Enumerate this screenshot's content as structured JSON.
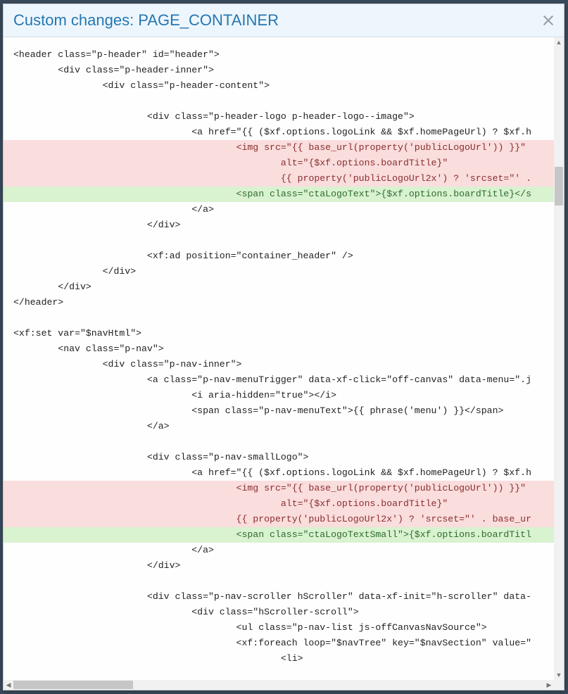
{
  "title": "Custom changes: PAGE_CONTAINER",
  "lines": [
    {
      "kind": "norm",
      "text": "<header class=\"p-header\" id=\"header\">"
    },
    {
      "kind": "norm",
      "text": "        <div class=\"p-header-inner\">"
    },
    {
      "kind": "norm",
      "text": "                <div class=\"p-header-content\">"
    },
    {
      "kind": "norm",
      "text": ""
    },
    {
      "kind": "norm",
      "text": "                        <div class=\"p-header-logo p-header-logo--image\">"
    },
    {
      "kind": "norm",
      "text": "                                <a href=\"{{ ($xf.options.logoLink && $xf.homePageUrl) ? $xf.h"
    },
    {
      "kind": "del",
      "text": "                                        <img src=\"{{ base_url(property('publicLogoUrl')) }}\""
    },
    {
      "kind": "del",
      "text": "                                                alt=\"{$xf.options.boardTitle}\""
    },
    {
      "kind": "del",
      "text": "                                                {{ property('publicLogoUrl2x') ? 'srcset=\"' ."
    },
    {
      "kind": "add",
      "text": "                                        <span class=\"ctaLogoText\">{$xf.options.boardTitle}</s"
    },
    {
      "kind": "norm",
      "text": "                                </a>"
    },
    {
      "kind": "norm",
      "text": "                        </div>"
    },
    {
      "kind": "norm",
      "text": ""
    },
    {
      "kind": "norm",
      "text": "                        <xf:ad position=\"container_header\" />"
    },
    {
      "kind": "norm",
      "text": "                </div>"
    },
    {
      "kind": "norm",
      "text": "        </div>"
    },
    {
      "kind": "norm",
      "text": "</header>"
    },
    {
      "kind": "norm",
      "text": ""
    },
    {
      "kind": "norm",
      "text": "<xf:set var=\"$navHtml\">"
    },
    {
      "kind": "norm",
      "text": "        <nav class=\"p-nav\">"
    },
    {
      "kind": "norm",
      "text": "                <div class=\"p-nav-inner\">"
    },
    {
      "kind": "norm",
      "text": "                        <a class=\"p-nav-menuTrigger\" data-xf-click=\"off-canvas\" data-menu=\".j"
    },
    {
      "kind": "norm",
      "text": "                                <i aria-hidden=\"true\"></i>"
    },
    {
      "kind": "norm",
      "text": "                                <span class=\"p-nav-menuText\">{{ phrase('menu') }}</span>"
    },
    {
      "kind": "norm",
      "text": "                        </a>"
    },
    {
      "kind": "norm",
      "text": ""
    },
    {
      "kind": "norm",
      "text": "                        <div class=\"p-nav-smallLogo\">"
    },
    {
      "kind": "norm",
      "text": "                                <a href=\"{{ ($xf.options.logoLink && $xf.homePageUrl) ? $xf.h"
    },
    {
      "kind": "del",
      "text": "                                        <img src=\"{{ base_url(property('publicLogoUrl')) }}\""
    },
    {
      "kind": "del",
      "text": "                                                alt=\"{$xf.options.boardTitle}\""
    },
    {
      "kind": "del",
      "text": "                                        {{ property('publicLogoUrl2x') ? 'srcset=\"' . base_ur"
    },
    {
      "kind": "add",
      "text": "                                        <span class=\"ctaLogoTextSmall\">{$xf.options.boardTitl"
    },
    {
      "kind": "norm",
      "text": "                                </a>"
    },
    {
      "kind": "norm",
      "text": "                        </div>"
    },
    {
      "kind": "norm",
      "text": ""
    },
    {
      "kind": "norm",
      "text": "                        <div class=\"p-nav-scroller hScroller\" data-xf-init=\"h-scroller\" data-"
    },
    {
      "kind": "norm",
      "text": "                                <div class=\"hScroller-scroll\">"
    },
    {
      "kind": "norm",
      "text": "                                        <ul class=\"p-nav-list js-offCanvasNavSource\">"
    },
    {
      "kind": "norm",
      "text": "                                        <xf:foreach loop=\"$navTree\" key=\"$navSection\" value=\""
    },
    {
      "kind": "norm",
      "text": "                                                <li>"
    }
  ]
}
